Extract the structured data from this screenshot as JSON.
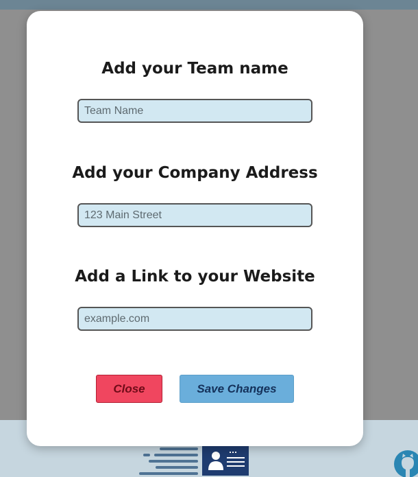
{
  "modal": {
    "team": {
      "heading": "Add your Team name",
      "placeholder": "Team Name",
      "value": ""
    },
    "address": {
      "heading": "Add your Company Address",
      "placeholder": "123 Main Street",
      "value": ""
    },
    "website": {
      "heading": "Add a Link to your Website",
      "placeholder": "example.com",
      "value": ""
    },
    "buttons": {
      "close_label": "Close",
      "save_label": "Save Changes"
    }
  },
  "footer": {
    "logo_icon": "id-card-lines-logo-icon",
    "github_icon": "github-icon"
  },
  "colors": {
    "backdrop": "#8f8f8f",
    "input_bg": "#d2e8f2",
    "close_button": "#f0465f",
    "save_button": "#6aaedb",
    "footer_bg": "#c6d6df",
    "logo_navy": "#1f3c70"
  }
}
